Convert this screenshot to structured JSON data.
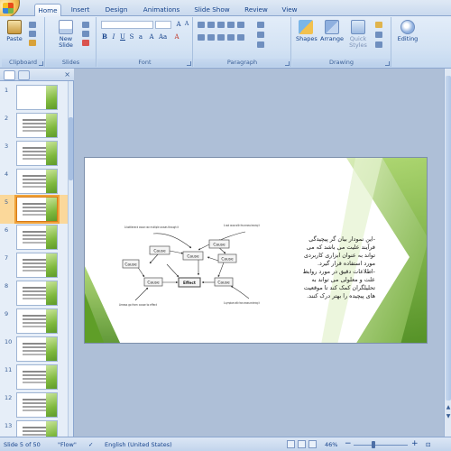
{
  "tabs": [
    {
      "label": "Home",
      "active": true
    },
    {
      "label": "Insert",
      "active": false
    },
    {
      "label": "Design",
      "active": false
    },
    {
      "label": "Animations",
      "active": false
    },
    {
      "label": "Slide Show",
      "active": false
    },
    {
      "label": "Review",
      "active": false
    },
    {
      "label": "View",
      "active": false
    }
  ],
  "ribbon": {
    "clipboard": {
      "group_label": "Clipboard",
      "paste_label": "Paste"
    },
    "slides": {
      "group_label": "Slides",
      "new_slide_label": "New Slide"
    },
    "font": {
      "group_label": "Font"
    },
    "paragraph": {
      "group_label": "Paragraph"
    },
    "drawing": {
      "group_label": "Drawing",
      "shapes_label": "Shapes",
      "arrange_label": "Arrange",
      "quick_styles_label": "Quick Styles"
    },
    "editing": {
      "label": "Editing"
    }
  },
  "slide_pane": {
    "thumbnails": [
      {
        "number": "1"
      },
      {
        "number": "2"
      },
      {
        "number": "3"
      },
      {
        "number": "4"
      },
      {
        "number": "5",
        "selected": true
      },
      {
        "number": "6"
      },
      {
        "number": "7"
      },
      {
        "number": "8"
      },
      {
        "number": "9"
      },
      {
        "number": "10"
      },
      {
        "number": "11"
      },
      {
        "number": "12"
      },
      {
        "number": "13"
      }
    ]
  },
  "slide": {
    "body_text": "-این نمودار بیان گر پیچیدگی فرآیند علیت می باشد که می تواند به عنوان ابزاری کاربردی مورد استفاده قرار گیرد. -اطلاعات دقیق در مورد روابط علت و معلولی می تواند به تحلیلگران کمک کند تا موقعیت های پیچیده را بهتر درک کنند.",
    "diagram": {
      "nodes": [
        "Cause",
        "Cause",
        "Cause",
        "Cause",
        "Cause",
        "Cause",
        "Cause",
        "Effect"
      ],
      "notes": {
        "top_left": "A bottleneck cause can multiple causes through it",
        "top_right": "A root cause with few arrows leaving it",
        "bottom_left": "Arrows go from cause to effect",
        "bottom_right": "A symptom with few arrows entering it"
      }
    }
  },
  "status_bar": {
    "slide_counter": "Slide 5 of 50",
    "theme": "\"Flow\"",
    "language": "English (United States)",
    "zoom": "46%"
  },
  "colors": {
    "ribbon_bg": "#d4e3f4",
    "accent_green": "#7fb93e",
    "selection_orange": "#f0a33a"
  }
}
